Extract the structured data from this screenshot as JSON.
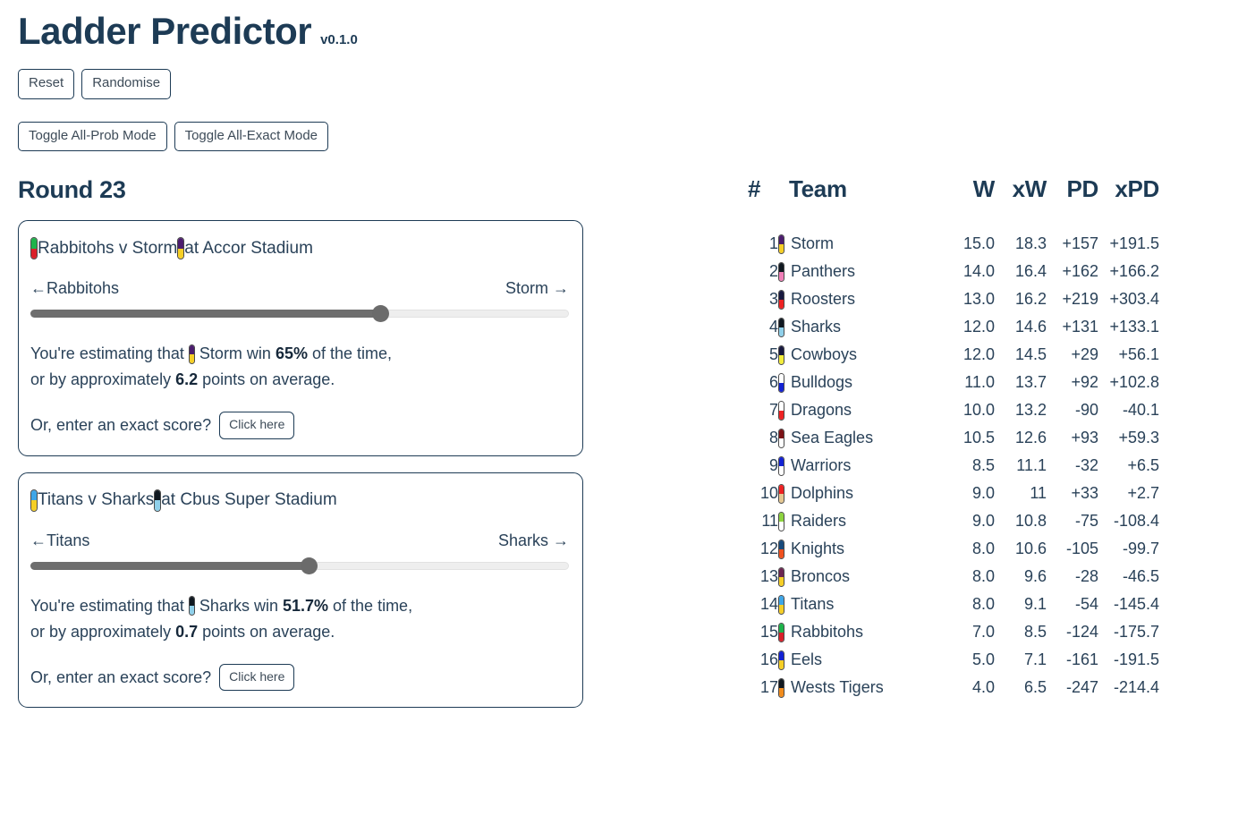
{
  "header": {
    "title": "Ladder Predictor",
    "version": "v0.1.0"
  },
  "toolbar": {
    "reset_label": "Reset",
    "randomise_label": "Randomise",
    "toggle_all_prob_label": "Toggle All-Prob Mode",
    "toggle_all_exact_label": "Toggle All-Exact Mode"
  },
  "round": {
    "title": "Round 23"
  },
  "matches": [
    {
      "home": "Rabbitohs",
      "away": "Storm",
      "home_colors": [
        "#1db34a",
        "#d9202a"
      ],
      "away_colors": [
        "#4b1c6e",
        "#f6cf26"
      ],
      "versus_text": "Rabbitohs v Storm",
      "at_text": "at Accor Stadium",
      "venue": "Accor Stadium",
      "slider_left_label": "←Rabbitohs",
      "slider_right_label": "Storm →",
      "slider_percent": 65,
      "estimate_prefix": "You're estimating that",
      "estimate_team": "Storm win",
      "estimate_percent": "65%",
      "estimate_suffix": "of the time,",
      "margin_prefix": "or by approximately",
      "margin_value": "6.2",
      "margin_suffix": "points on average.",
      "exact_prompt": "Or, enter an exact score?",
      "exact_button": "Click here"
    },
    {
      "home": "Titans",
      "away": "Sharks",
      "home_colors": [
        "#3ea6e8",
        "#f6cf26"
      ],
      "away_colors": [
        "#101820",
        "#8fd0ea"
      ],
      "versus_text": "Titans v Sharks",
      "at_text": "at Cbus Super Stadium",
      "venue": "Cbus Super Stadium",
      "slider_left_label": "←Titans",
      "slider_right_label": "Sharks →",
      "slider_percent": 51.7,
      "estimate_prefix": "You're estimating that",
      "estimate_team": "Sharks win",
      "estimate_percent": "51.7%",
      "estimate_suffix": "of the time,",
      "margin_prefix": "or by approximately",
      "margin_value": "0.7",
      "margin_suffix": "points on average.",
      "exact_prompt": "Or, enter an exact score?",
      "exact_button": "Click here"
    }
  ],
  "ladder": {
    "columns": [
      "#",
      "Team",
      "W",
      "xW",
      "PD",
      "xPD"
    ],
    "rows": [
      {
        "rank": "1",
        "team": "Storm",
        "colors": [
          "#4b1c6e",
          "#f6cf26"
        ],
        "w": "15.0",
        "xw": "18.3",
        "pd": "+157",
        "xpd": "+191.5"
      },
      {
        "rank": "2",
        "team": "Panthers",
        "colors": [
          "#101820",
          "#f07fb8"
        ],
        "w": "14.0",
        "xw": "16.4",
        "pd": "+162",
        "xpd": "+166.2"
      },
      {
        "rank": "3",
        "team": "Roosters",
        "colors": [
          "#18193f",
          "#ee2223"
        ],
        "w": "13.0",
        "xw": "16.2",
        "pd": "+219",
        "xpd": "+303.4"
      },
      {
        "rank": "4",
        "team": "Sharks",
        "colors": [
          "#101820",
          "#8fd0ea"
        ],
        "w": "12.0",
        "xw": "14.6",
        "pd": "+131",
        "xpd": "+133.1"
      },
      {
        "rank": "5",
        "team": "Cowboys",
        "colors": [
          "#18193f",
          "#f4ee3b"
        ],
        "w": "12.0",
        "xw": "14.5",
        "pd": "+29",
        "xpd": "+56.1"
      },
      {
        "rank": "6",
        "team": "Bulldogs",
        "colors": [
          "#ffffff",
          "#1322d4"
        ],
        "w": "11.0",
        "xw": "13.7",
        "pd": "+92",
        "xpd": "+102.8"
      },
      {
        "rank": "7",
        "team": "Dragons",
        "colors": [
          "#ffffff",
          "#ee2223"
        ],
        "w": "10.0",
        "xw": "13.2",
        "pd": "-90",
        "xpd": "-40.1"
      },
      {
        "rank": "8",
        "team": "Sea Eagles",
        "colors": [
          "#7b1216",
          "#ffffff"
        ],
        "w": "10.5",
        "xw": "12.6",
        "pd": "+93",
        "xpd": "+59.3"
      },
      {
        "rank": "9",
        "team": "Warriors",
        "colors": [
          "#1322d4",
          "#ffffff"
        ],
        "w": "8.5",
        "xw": "11.1",
        "pd": "-32",
        "xpd": "+6.5"
      },
      {
        "rank": "10",
        "team": "Dolphins",
        "colors": [
          "#ee2223",
          "#e5c892"
        ],
        "w": "9.0",
        "xw": "11",
        "pd": "+33",
        "xpd": "+2.7"
      },
      {
        "rank": "11",
        "team": "Raiders",
        "colors": [
          "#8dd33f",
          "#ffffff"
        ],
        "w": "9.0",
        "xw": "10.8",
        "pd": "-75",
        "xpd": "-108.4"
      },
      {
        "rank": "12",
        "team": "Knights",
        "colors": [
          "#174a7c",
          "#f0511e"
        ],
        "w": "8.0",
        "xw": "10.6",
        "pd": "-105",
        "xpd": "-99.7"
      },
      {
        "rank": "13",
        "team": "Broncos",
        "colors": [
          "#6b2551",
          "#f6cf26"
        ],
        "w": "8.0",
        "xw": "9.6",
        "pd": "-28",
        "xpd": "-46.5"
      },
      {
        "rank": "14",
        "team": "Titans",
        "colors": [
          "#3ea6e8",
          "#f6cf26"
        ],
        "w": "8.0",
        "xw": "9.1",
        "pd": "-54",
        "xpd": "-145.4"
      },
      {
        "rank": "15",
        "team": "Rabbitohs",
        "colors": [
          "#1db34a",
          "#d9202a"
        ],
        "w": "7.0",
        "xw": "8.5",
        "pd": "-124",
        "xpd": "-175.7"
      },
      {
        "rank": "16",
        "team": "Eels",
        "colors": [
          "#1322d4",
          "#f6cf26"
        ],
        "w": "5.0",
        "xw": "7.1",
        "pd": "-161",
        "xpd": "-191.5"
      },
      {
        "rank": "17",
        "team": "Wests Tigers",
        "colors": [
          "#101820",
          "#f28c1c"
        ],
        "w": "4.0",
        "xw": "6.5",
        "pd": "-247",
        "xpd": "-214.4"
      }
    ]
  }
}
